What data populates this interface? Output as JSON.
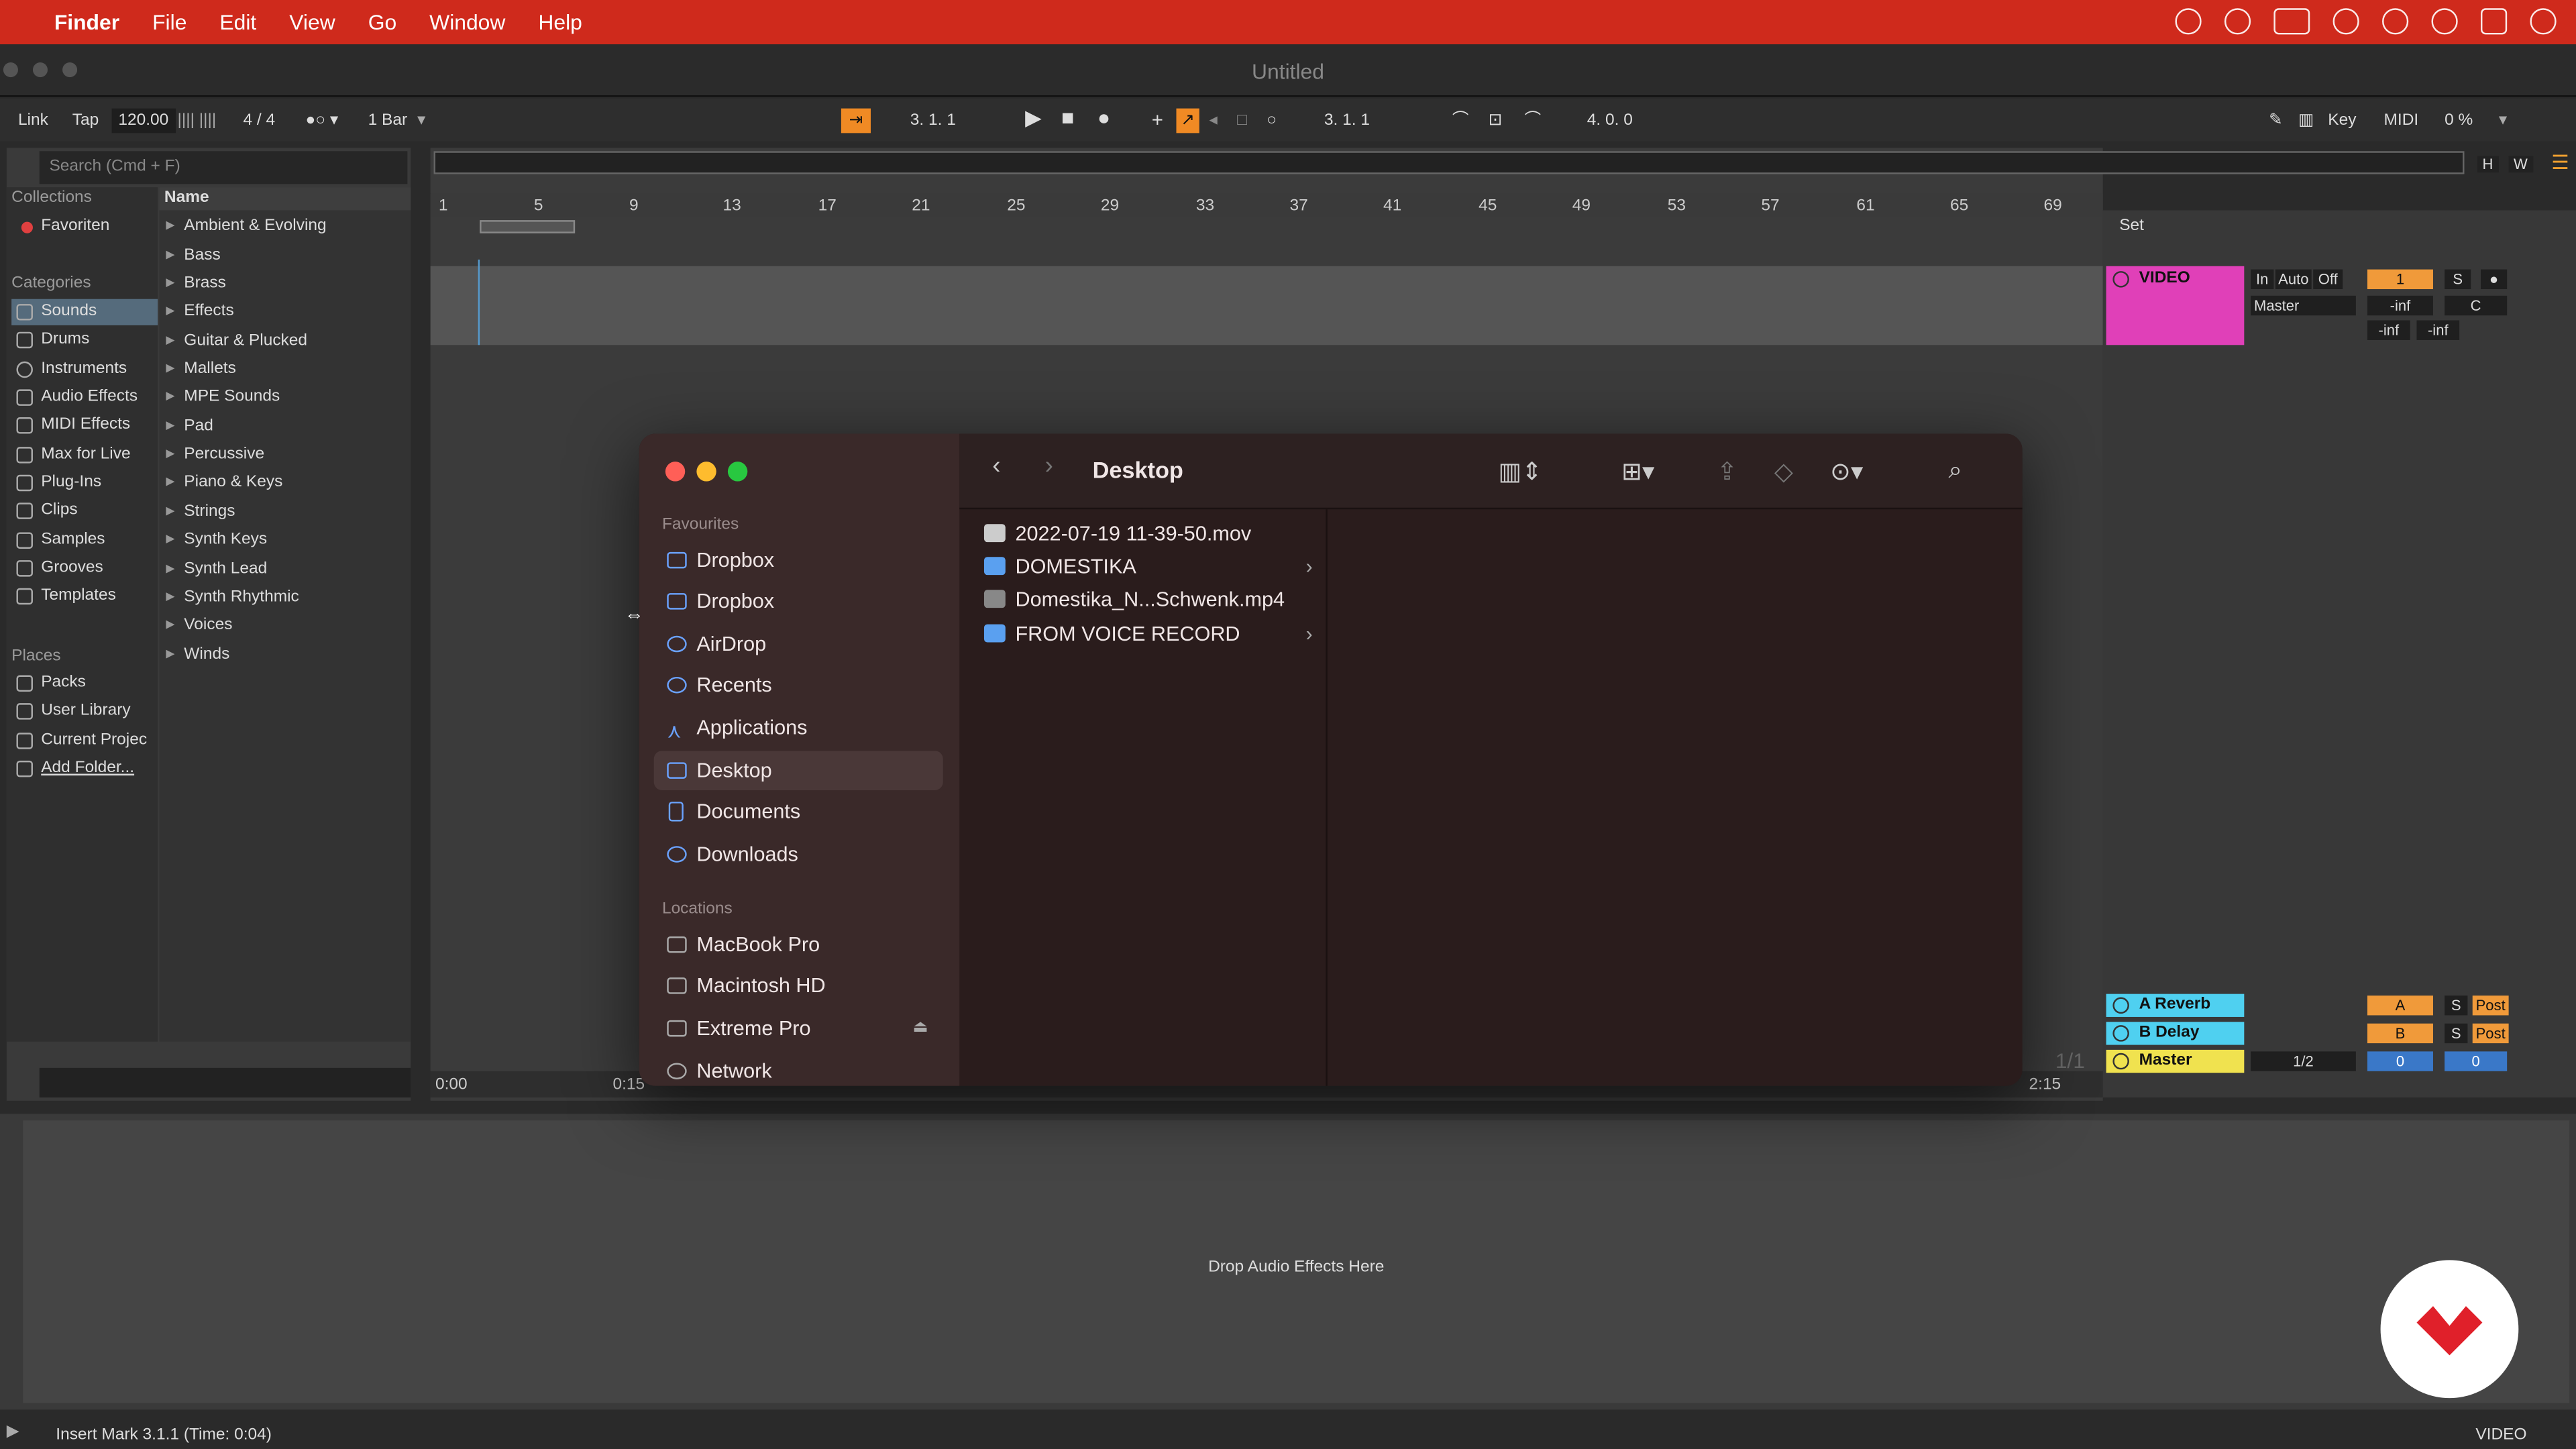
{
  "menubar": {
    "app": "Finder",
    "items": [
      "File",
      "Edit",
      "View",
      "Go",
      "Window",
      "Help"
    ]
  },
  "window": {
    "title": "Untitled"
  },
  "control": {
    "link": "Link",
    "tap": "Tap",
    "tempo": "120.00",
    "signature": "4 / 4",
    "quantize": "1 Bar",
    "position": "3.  1.  1",
    "loop_start": "3.  1.  1",
    "loop_length": "4.  0.  0",
    "key": "Key",
    "midi": "MIDI",
    "cpu": "0 %"
  },
  "browser": {
    "search_placeholder": "Search (Cmd + F)",
    "collections_header": "Collections",
    "collections": [
      "Favoriten"
    ],
    "categories_header": "Categories",
    "categories": [
      "Sounds",
      "Drums",
      "Instruments",
      "Audio Effects",
      "MIDI Effects",
      "Max for Live",
      "Plug-Ins",
      "Clips",
      "Samples",
      "Grooves",
      "Templates"
    ],
    "places_header": "Places",
    "places": [
      "Packs",
      "User Library",
      "Current Projec",
      "Add Folder..."
    ],
    "name_header": "Name",
    "names": [
      "Ambient & Evolving",
      "Bass",
      "Brass",
      "Effects",
      "Guitar & Plucked",
      "Mallets",
      "MPE Sounds",
      "Pad",
      "Percussive",
      "Piano & Keys",
      "Strings",
      "Synth Keys",
      "Synth Lead",
      "Synth Rhythmic",
      "Voices",
      "Winds"
    ]
  },
  "arrangement": {
    "bars": [
      "1",
      "5",
      "9",
      "13",
      "17",
      "21",
      "25",
      "29",
      "33",
      "37",
      "41",
      "45",
      "49",
      "53",
      "57",
      "61",
      "65",
      "69"
    ],
    "times": [
      "0:00",
      "0:15",
      "2:15"
    ],
    "hw": [
      "H",
      "W"
    ],
    "set_label": "Set",
    "page": "1/1"
  },
  "mixer": {
    "video_track": "VIDEO",
    "in": "In",
    "auto": "Auto",
    "off": "Off",
    "track_num": "1",
    "solo": "S",
    "output": "Master",
    "inf1": "-inf",
    "pan": "C",
    "inf2": "-inf",
    "inf3": "-inf",
    "returns": [
      {
        "name": "A Reverb",
        "btn": "A",
        "solo": "S",
        "post": "Post",
        "color": "#4fd0f0"
      },
      {
        "name": "B Delay",
        "btn": "B",
        "solo": "S",
        "post": "Post",
        "color": "#4fd0f0"
      },
      {
        "name": "Master",
        "btn": "1/2",
        "v1": "0",
        "v2": "0",
        "color": "#f0e24f"
      }
    ]
  },
  "detail": {
    "drop_text": "Drop Audio Effects Here"
  },
  "status": {
    "text": "Insert Mark 3.1.1 (Time: 0:04)",
    "right": "VIDEO"
  },
  "finder": {
    "title": "Desktop",
    "favourites_header": "Favourites",
    "favourites": [
      "Dropbox",
      "Dropbox",
      "AirDrop",
      "Recents",
      "Applications",
      "Desktop",
      "Documents",
      "Downloads"
    ],
    "locations_header": "Locations",
    "locations": [
      "MacBook Pro",
      "Macintosh HD",
      "Extreme Pro",
      "Network"
    ],
    "files": [
      {
        "name": "2022-07-19 11-39-50.mov",
        "type": "file"
      },
      {
        "name": "DOMESTIKA",
        "type": "folder"
      },
      {
        "name": "Domestika_N...Schwenk.mp4",
        "type": "file"
      },
      {
        "name": "FROM VOICE RECORD",
        "type": "folder"
      }
    ]
  }
}
